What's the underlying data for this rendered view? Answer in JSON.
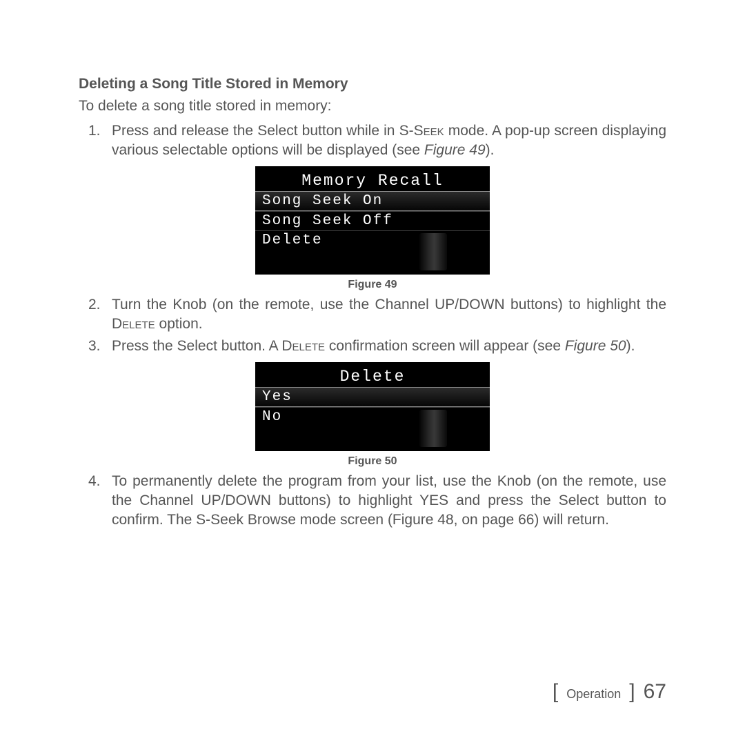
{
  "heading": "Deleting a Song Title Stored in Memory",
  "intro": "To delete a song title stored in memory:",
  "steps": {
    "s1_a": "Press and release the Select button while in S-S",
    "s1_b": "eek",
    "s1_c": " mode.  A pop-up screen displaying various selectable options will be displayed (see ",
    "s1_fig": "Figure 49",
    "s1_end": ").",
    "s2_a": "Turn the Knob (on the remote, use the Channel UP/DOWN buttons) to highlight the D",
    "s2_b": "elete",
    "s2_c": " option.",
    "s3_a": "Press the Select button. A D",
    "s3_b": "elete",
    "s3_c": " confirmation screen will appear (see ",
    "s3_fig": "Figure 50",
    "s3_end": ").",
    "s4": "To permanently delete the program from your list, use the Knob (on the remote, use the Channel UP/DOWN buttons) to highlight YES and press the Select button to confirm. The S-Seek Browse mode screen (Figure 48, on page 66) will return."
  },
  "screens": {
    "fig49": {
      "title": "Memory Recall",
      "opts": [
        "Song Seek On",
        "Song Seek Off",
        "Delete"
      ],
      "caption": "Figure 49"
    },
    "fig50": {
      "title": "Delete",
      "opts": [
        "Yes",
        "No"
      ],
      "caption": "Figure 50"
    }
  },
  "footer": {
    "section": "Operation",
    "page": "67",
    "lbrk": "[",
    "rbrk": "]"
  }
}
